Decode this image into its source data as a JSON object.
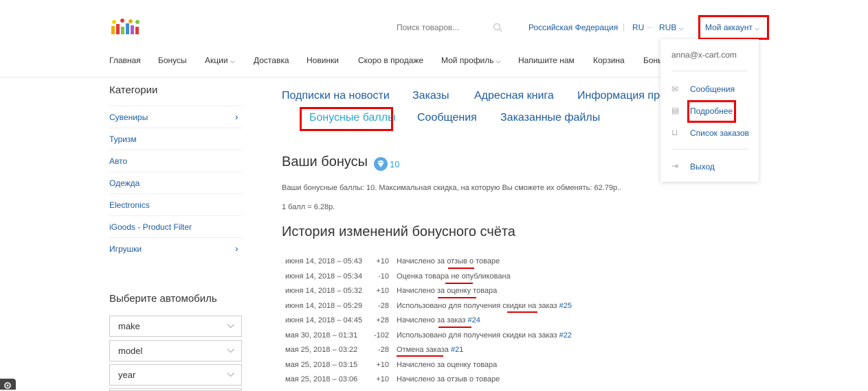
{
  "header": {
    "search_placeholder": "Поиск товаров...",
    "country": "Российская Федерация",
    "language": "RU",
    "currency": "RUB",
    "account": "Мой аккаунт"
  },
  "menu": [
    "Главная",
    "Бонусы",
    "Акции",
    "Доставка",
    "Новинки",
    "Скоро в продаже",
    "Мой профиль",
    "Напишите нам",
    "Корзина",
    "Бонь"
  ],
  "sidebar": {
    "title": "Категории",
    "categories": [
      "Сувениры",
      "Туризм",
      "Авто",
      "Одежда",
      "Electronics",
      "iGoods - Product Filter",
      "Игрушки"
    ],
    "car_title": "Выберите автомобиль",
    "car_selects": [
      "make",
      "model",
      "year"
    ]
  },
  "tabs": {
    "row1": [
      "Подписки на новости",
      "Заказы",
      "Адресная книга",
      "Информация про"
    ],
    "row2": [
      "Бонусные баллы",
      "Сообщения",
      "Заказанные файлы"
    ]
  },
  "bonus": {
    "title": "Ваши бонусы",
    "count": "10",
    "info": "Ваши бонусные баллы: 10. Максимальная скидка, на которую Вы сможете их обменять: 62.79р..",
    "rate": "1 балл = 6.28р.",
    "history_title": "История изменений бонусного счёта"
  },
  "history": [
    {
      "date": "июня 14, 2018 – 05:43",
      "amount": "+10",
      "text": "Начислено за отзыв о товаре",
      "link": ""
    },
    {
      "date": "июня 14, 2018 – 05:34",
      "amount": "-10",
      "text": "Оценка товара не опубликована",
      "link": ""
    },
    {
      "date": "июня 14, 2018 – 05:32",
      "amount": "+10",
      "text": "Начислено за оценку товара",
      "link": ""
    },
    {
      "date": "июня 14, 2018 – 05:29",
      "amount": "-28",
      "text": "Использовано для получения скидки на заказ ",
      "link": "#25"
    },
    {
      "date": "июня 14, 2018 – 04:45",
      "amount": "+28",
      "text": "Начислено за заказ ",
      "link": "#24"
    },
    {
      "date": "мая 30, 2018 – 01:31",
      "amount": "-102",
      "text": "Использовано для получения скидки на заказ ",
      "link": "#22"
    },
    {
      "date": "мая 25, 2018 – 03:22",
      "amount": "-28",
      "text": "Отмена заказа ",
      "link": "#21"
    },
    {
      "date": "мая 25, 2018 – 03:15",
      "amount": "+10",
      "text": "Начислено за оценку товара",
      "link": ""
    },
    {
      "date": "мая 25, 2018 – 03:06",
      "amount": "+10",
      "text": "Начислено за отзыв о товаре",
      "link": ""
    }
  ],
  "account_dropdown": {
    "email": "anna@x-cart.com",
    "items": [
      "Сообщения",
      "Подробнее",
      "Список заказов"
    ],
    "logout": "Выход"
  },
  "colors": {
    "link": "#1c5ca0",
    "highlight": "#e00000",
    "active_tab": "#29a7d1"
  }
}
